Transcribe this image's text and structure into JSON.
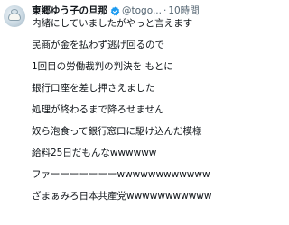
{
  "author": {
    "display_name": "東郷ゆう子の旦那",
    "handle": "@togo...",
    "separator": "·",
    "timestamp": "10時間"
  },
  "tweet": {
    "lines": [
      "内緒にしていましたがやっと言えます",
      "民商が金を払わず逃げ回るので",
      "1回目の労働裁判の判決を もとに",
      "銀行口座を差し押さえました",
      "処理が終わるまで降ろせません",
      "奴ら泡食って銀行窓口に駆け込んだ模様",
      "給料25日だもんなwwwwww",
      "ファーーーーーーーwwwwwwwwwwww",
      "ざまぁみろ日本共産党wwwwwwwwwww"
    ]
  },
  "colors": {
    "text": "#0f1419",
    "secondary": "#536471",
    "verified": "#1d9bf0"
  }
}
